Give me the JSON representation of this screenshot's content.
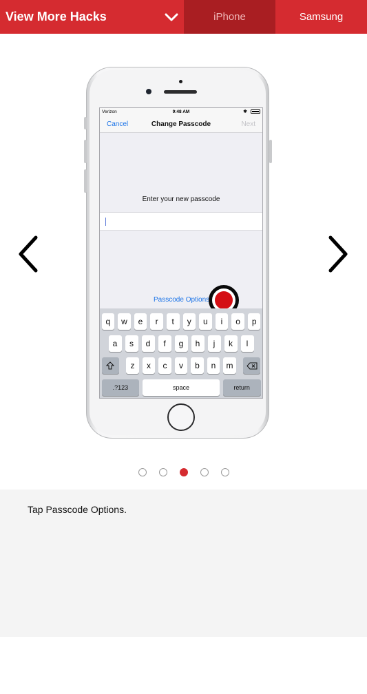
{
  "header": {
    "title": "View More Hacks",
    "tabs": [
      {
        "label": "iPhone",
        "active": true
      },
      {
        "label": "Samsung",
        "active": false
      }
    ]
  },
  "colors": {
    "brand_red": "#d52b30",
    "active_tab": "#a91e22",
    "link_blue": "#1a73e8",
    "tap_red": "#d40e14"
  },
  "phone_screen": {
    "status": {
      "carrier": "Verizon",
      "time": "9:48 AM"
    },
    "nav": {
      "cancel": "Cancel",
      "title": "Change Passcode",
      "next": "Next"
    },
    "prompt": "Enter your new passcode",
    "options_link": "Passcode Options",
    "keyboard": {
      "row1": [
        "q",
        "w",
        "e",
        "r",
        "t",
        "y",
        "u",
        "i",
        "o",
        "p"
      ],
      "row2": [
        "a",
        "s",
        "d",
        "f",
        "g",
        "h",
        "j",
        "k",
        "l"
      ],
      "row3": [
        "z",
        "x",
        "c",
        "v",
        "b",
        "n",
        "m"
      ],
      "shift_icon": "shift-icon",
      "delete_icon": "delete-icon",
      "numbers": ".?123",
      "space": "space",
      "return": "return"
    }
  },
  "pagination": {
    "total": 5,
    "active_index": 2
  },
  "caption": "Tap Passcode Options."
}
